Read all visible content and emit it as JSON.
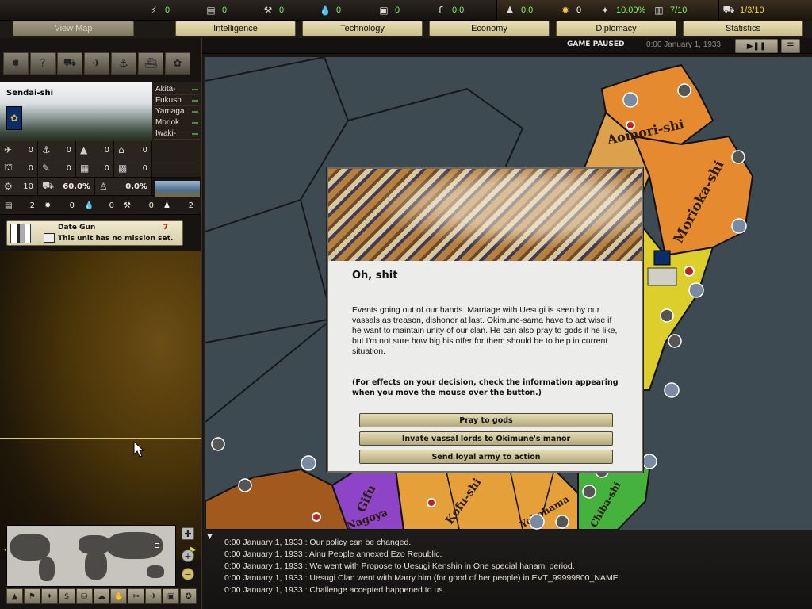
{
  "resources": [
    {
      "icon": "energy-icon",
      "glyph": "⚡",
      "value": "0"
    },
    {
      "icon": "metal-icon",
      "glyph": "▤",
      "value": "0"
    },
    {
      "icon": "rare-materials-icon",
      "glyph": "⚒",
      "value": "0"
    },
    {
      "icon": "oil-icon",
      "glyph": "💧",
      "value": "0"
    },
    {
      "icon": "supplies-icon",
      "glyph": "▣",
      "value": "0"
    },
    {
      "icon": "money-icon",
      "glyph": "£",
      "value": "0.0"
    },
    {
      "icon": "manpower-icon",
      "glyph": "♟",
      "value": "0.0"
    },
    {
      "icon": "nuke-icon",
      "glyph": "✹",
      "value": "0"
    },
    {
      "icon": "dissent-icon",
      "glyph": "✦",
      "value": "10.00%"
    },
    {
      "icon": "transport-icon",
      "glyph": "▥",
      "value": "7/10"
    },
    {
      "icon": "convoy-icon",
      "glyph": "⛟",
      "value": "1/3/10"
    }
  ],
  "tabs": {
    "view_map": "View Map",
    "intelligence": "Intelligence",
    "technology": "Technology",
    "economy": "Economy",
    "diplomacy": "Diplomacy",
    "statistics": "Statistics"
  },
  "status": {
    "paused": "GAME PAUSED",
    "date": "0:00 January 1, 1933"
  },
  "province": {
    "name": "Sendai-shi",
    "neighbors": [
      "Akita-",
      "Fukush",
      "Yamaga",
      "Moriok",
      "Iwaki-"
    ],
    "stats_row1": [
      "0",
      "0",
      "0",
      "0"
    ],
    "stats_row2": [
      "0",
      "0",
      "0",
      "0"
    ],
    "stats_row3": {
      "a": "10",
      "b": "60.0%",
      "c": "0.0%"
    },
    "res_row": [
      "2",
      "0",
      "0",
      "0",
      "2"
    ]
  },
  "unit": {
    "name": "Date Gun",
    "count": "7",
    "mission": "This unit has no mission set."
  },
  "event": {
    "title": "Oh, shit",
    "body": "Events going out of our hands. Marriage with Uesugi is seen by our vassals as treason, dishonor at last. Okimune-sama have to act wise if he want to maintain unity of our clan. He can also pray to gods if he like, but I'm not sure how big his offer for them should be to help in current situation.",
    "note": "(For effects on your decision, check the information appearing when you move the mouse over the button.)",
    "options": [
      "Pray to gods",
      "Invate vassal lords to Okimune's manor",
      "Send loyal army to action"
    ]
  },
  "map_labels": [
    "Aomori-shi",
    "Morioka-shi",
    "Gifu",
    "Kofu-shi",
    "Yokohama",
    "Chiba-shi",
    "Nagoya"
  ],
  "log": [
    "0:00 January 1, 1933 : Our policy can be changed.",
    "0:00 January 1, 1933 : Ainu People annexed Ezo Republic.",
    "0:00 January 1, 1933 : We went with Propose to Uesugi Kenshin in One special hanami period.",
    "0:00 January 1, 1933 : Uesugi Clan went with Marry him (for good of her people) in EVT_99999800_NAME.",
    "0:00 January 1, 1933 : Challenge accepted happened to us."
  ],
  "colors": {
    "resource_value": "#7cf26a",
    "sea": "#3e4a52",
    "province_yellow": "#dccf2c",
    "province_orange": "#e58a2e",
    "province_purple": "#8e44c7",
    "province_green": "#45b23d"
  }
}
